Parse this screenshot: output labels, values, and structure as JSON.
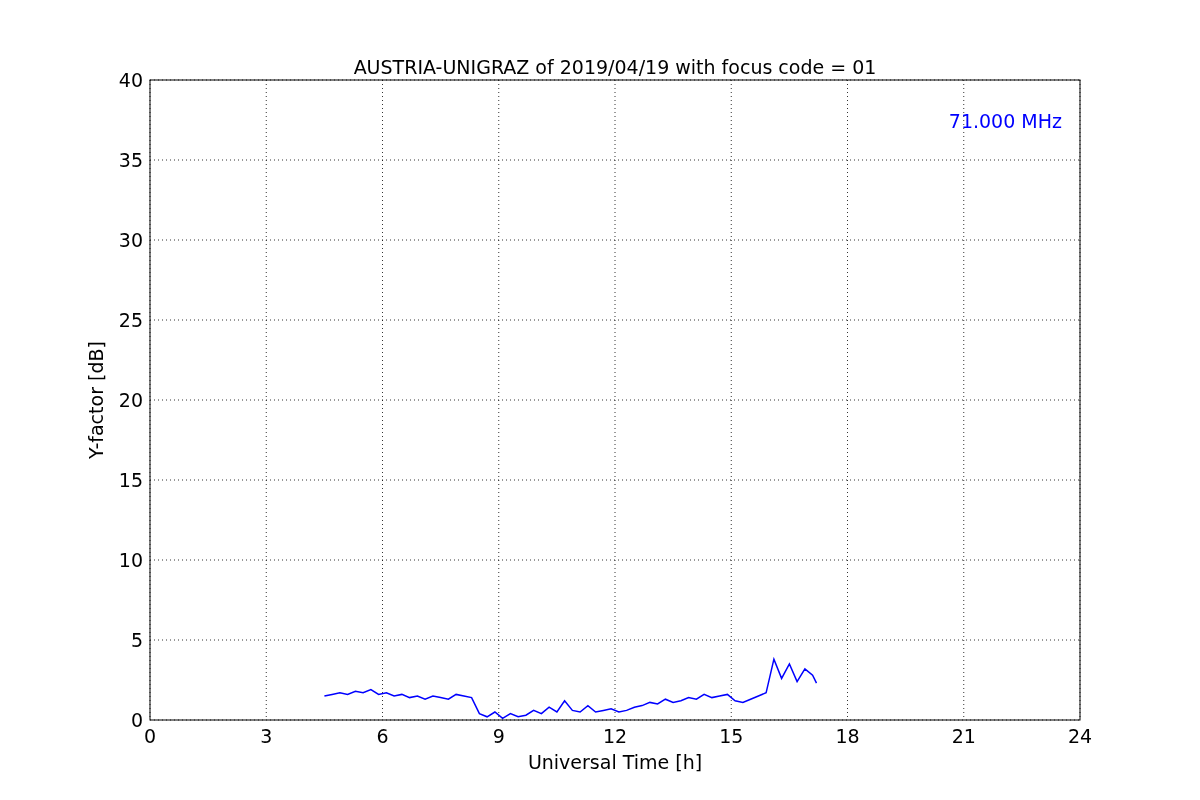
{
  "chart_data": {
    "type": "line",
    "title": "AUSTRIA-UNIGRAZ of 2019/04/19 with focus code = 01",
    "xlabel": "Universal Time [h]",
    "ylabel": "Y-factor [dB]",
    "x": [
      4.5,
      4.7,
      4.9,
      5.1,
      5.3,
      5.5,
      5.7,
      5.9,
      6.1,
      6.3,
      6.5,
      6.7,
      6.9,
      7.1,
      7.3,
      7.5,
      7.7,
      7.9,
      8.1,
      8.3,
      8.5,
      8.7,
      8.9,
      9.1,
      9.3,
      9.5,
      9.7,
      9.9,
      10.1,
      10.3,
      10.5,
      10.7,
      10.9,
      11.1,
      11.3,
      11.5,
      11.7,
      11.9,
      12.1,
      12.3,
      12.5,
      12.7,
      12.9,
      13.1,
      13.3,
      13.5,
      13.7,
      13.9,
      14.1,
      14.3,
      14.5,
      14.7,
      14.9,
      15.1,
      15.3,
      15.5,
      15.7,
      15.9,
      16.1,
      16.3,
      16.5,
      16.7,
      16.9,
      17.1,
      17.2
    ],
    "series": [
      {
        "name": "71.000 MHz",
        "color": "#0000ff",
        "values": [
          1.5,
          1.6,
          1.7,
          1.6,
          1.8,
          1.7,
          1.9,
          1.6,
          1.7,
          1.5,
          1.6,
          1.4,
          1.5,
          1.3,
          1.5,
          1.4,
          1.3,
          1.6,
          1.5,
          1.4,
          0.4,
          0.2,
          0.5,
          0.1,
          0.4,
          0.2,
          0.3,
          0.6,
          0.4,
          0.8,
          0.5,
          1.2,
          0.6,
          0.5,
          0.9,
          0.5,
          0.6,
          0.7,
          0.5,
          0.6,
          0.8,
          0.9,
          1.1,
          1.0,
          1.3,
          1.1,
          1.2,
          1.4,
          1.3,
          1.6,
          1.4,
          1.5,
          1.6,
          1.2,
          1.1,
          1.3,
          1.5,
          1.7,
          3.8,
          2.6,
          3.5,
          2.4,
          3.2,
          2.8,
          2.3
        ]
      }
    ],
    "xlim": [
      0,
      24
    ],
    "ylim": [
      0,
      40
    ],
    "xticks": [
      0,
      3,
      6,
      9,
      12,
      15,
      18,
      21,
      24
    ],
    "yticks": [
      0,
      5,
      10,
      15,
      20,
      25,
      30,
      35,
      40
    ],
    "grid": true
  }
}
